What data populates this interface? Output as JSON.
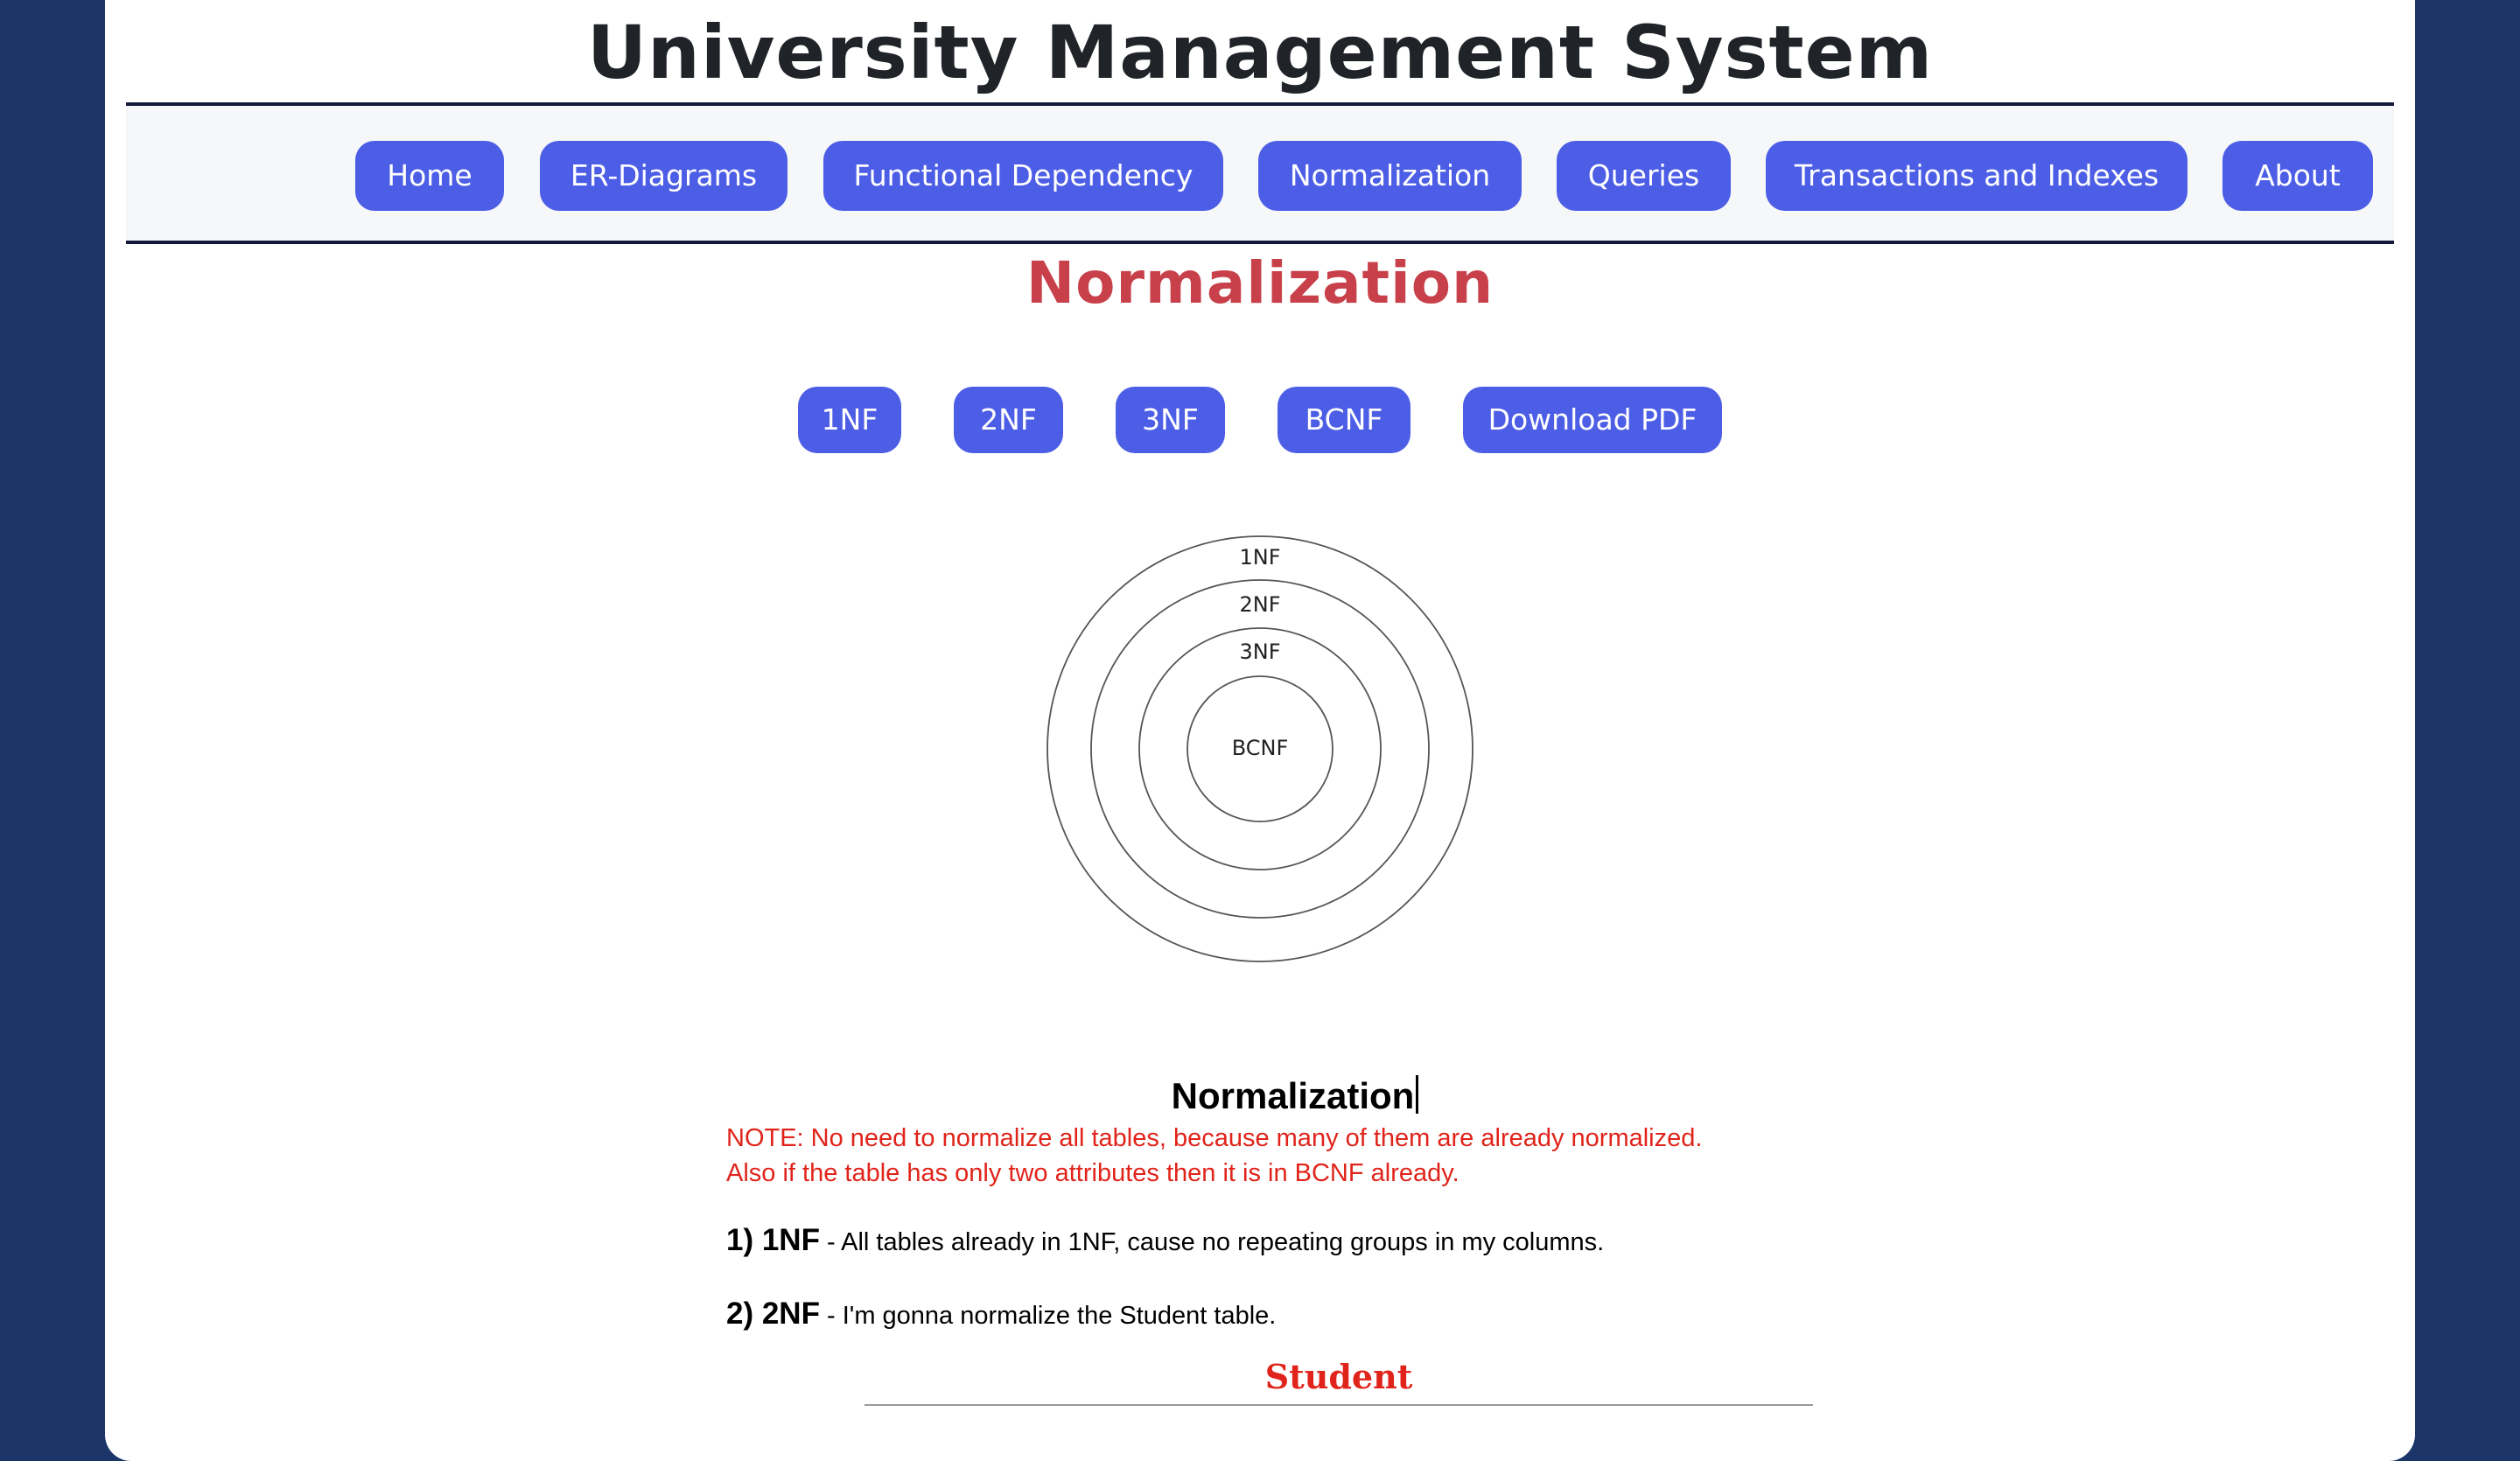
{
  "header": {
    "title": "University Management System"
  },
  "nav": {
    "items": [
      {
        "label": "Home"
      },
      {
        "label": "ER-Diagrams"
      },
      {
        "label": "Functional Dependency"
      },
      {
        "label": "Normalization"
      },
      {
        "label": "Queries"
      },
      {
        "label": "Transactions and Indexes"
      },
      {
        "label": "About"
      }
    ]
  },
  "main": {
    "heading": "Normalization",
    "subnav": [
      {
        "label": "1NF"
      },
      {
        "label": "2NF"
      },
      {
        "label": "3NF"
      },
      {
        "label": "BCNF"
      },
      {
        "label": "Download PDF"
      }
    ],
    "diagram": {
      "labels": [
        "1NF",
        "2NF",
        "3NF",
        "BCNF"
      ]
    },
    "doc": {
      "title": "Normalization",
      "note_lines": [
        "NOTE: No need to normalize all tables, because many of them are already normalized.",
        "Also if the table has only two attributes then it is in BCNF already."
      ],
      "points": [
        {
          "num": "1) 1NF",
          "text": " - All tables already in 1NF, cause no repeating groups in my columns."
        },
        {
          "num": "2) 2NF",
          "text": " - I'm gonna normalize the Student table."
        }
      ],
      "table_caption": "Student"
    }
  },
  "colors": {
    "page_background": "#1b3569",
    "button": "#4d5ee6",
    "heading": "#c8404a",
    "note": "#e0241b"
  }
}
